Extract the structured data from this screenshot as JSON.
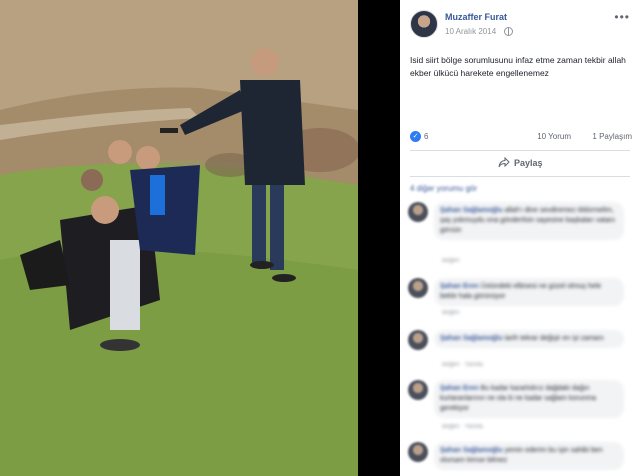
{
  "post": {
    "author": "Muzaffer Furat",
    "date": "10 Aralık 2014",
    "text": "Isid siirt bölge sorumlusunu infaz etme zaman tekbir allah ekber ülkücü harekete engellenemez",
    "reactions_count": "6",
    "comments_count": "10 Yorum",
    "shares_count": "1 Paylaşım",
    "share_label": "Paylaş",
    "more_menu": "•••",
    "like_glyph": "👍"
  },
  "comments_header": "4 diğer yorumu gör",
  "comments": [
    {
      "name": "Şahan Sağlamoğlu",
      "text": "allah'ı dine sevdiremez öldürmelim, şaş yokmuydu ona gönderilsin sayesine başkaları vatanı görsün",
      "meta": "Beğen"
    },
    {
      "name": "Şahan Eren",
      "text": "Üstündeki elbisesi ne güzel olmuş hele bekle hala görünüyor",
      "meta": "Beğen"
    },
    {
      "name": "Şahan Sağlamoğlu",
      "text": "tarih tekrar değişir en iyi zamanı",
      "meta": "Beğen · Yanıtla"
    },
    {
      "name": "Şahan Eren",
      "text": "Bu kadar kararlıdırız dağdaki dağın kurtaranlarının ne ola ki ne kadar sağlam korunma gerekiyor",
      "meta": "Beğen · Yanıtla"
    },
    {
      "name": "Şahan Sağlamoğlu",
      "text": "yemin ederim bu işin sahibi ben olursam kimse bilmez",
      "meta": ""
    }
  ]
}
